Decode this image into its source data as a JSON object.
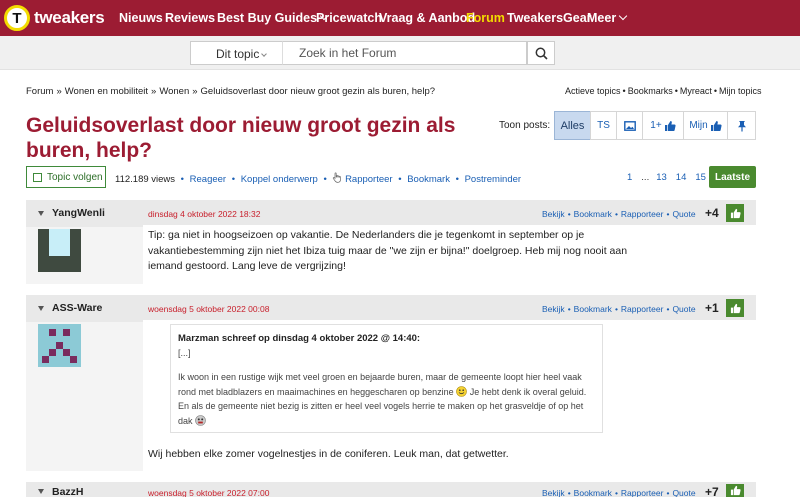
{
  "nav": {
    "logo_glyph": "T",
    "logo_text": "tweakers",
    "items": [
      "Nieuws",
      "Reviews",
      "Best Buy Guides",
      "Pricewatch",
      "Vraag & Aanbod",
      "Forum",
      "TweakersGear",
      "Meer"
    ],
    "active_item": "Forum",
    "brand_color": "#9c1c33",
    "active_color": "#f3dc00"
  },
  "search": {
    "scope": "Dit topic",
    "placeholder": "Zoek in het Forum",
    "icon": "search-icon"
  },
  "breadcrumb": [
    "Forum",
    "Wonen en mobiliteit",
    "Wonen",
    "Geluidsoverlast door nieuw groot gezin als buren, help?"
  ],
  "breadcrumb_separator": "»",
  "top_links": [
    "Actieve topics",
    "Bookmarks",
    "Myreact",
    "Mijn topics"
  ],
  "title": "Geluidsoverlast door nieuw groot gezin als buren, help?",
  "toon_posts": {
    "label": "Toon posts:",
    "options": [
      "Alles",
      "TS",
      "image-icon",
      "1+",
      "Mijn",
      "pin-icon"
    ],
    "selected": "Alles"
  },
  "actions": {
    "follow_label": "Topic volgen",
    "views": "112.189 views",
    "links": [
      "Reageer",
      "Koppel onderwerp",
      "Rapporteer",
      "Bookmark",
      "Postreminder"
    ]
  },
  "pagination": {
    "pages": [
      "1",
      "13",
      "14",
      "15"
    ],
    "ellipsis": "...",
    "last_label": "Laatste"
  },
  "post_action_labels": [
    "Bekijk",
    "Bookmark",
    "Rapporteer",
    "Quote"
  ],
  "posts": [
    {
      "author": "YangWenli",
      "date": "dinsdag 4 oktober 2022 18:32",
      "score": "+4",
      "text": "Tip: ga niet in hoogseizoen op vakantie. De Nederlanders die je tegenkomt in september op je vakantiebestemming zijn niet het Ibiza tuig maar de \"we zijn er bijna!\" doelgroep. Heb mij nog nooit aan iemand gestoord. Lang leve de vergrijzing!"
    },
    {
      "author": "ASS-Ware",
      "date": "woensdag 5 oktober 2022 00:08",
      "score": "+1",
      "quote": {
        "header": "Marzman schreef op dinsdag 4 oktober 2022 @ 14:40:",
        "ellipsis": "[...]",
        "text_1": "Ik woon in een rustige wijk met veel groen en bejaarde buren, maar de gemeente loopt hier heel vaak rond met bladblazers en maaimachines en heggescharen op benzine",
        "text_2": " Je hebt denk ik overal geluid. En als de gemeente niet bezig is zitten er heel veel vogels herrie te maken op het grasveldje of op het dak"
      },
      "text": "Wij hebben elke zomer vogelnestjes in de coniferen. Leuk man, dat getwetter."
    },
    {
      "author": "BazzH",
      "date": "woensdag 5 oktober 2022 07:00",
      "score": "+7"
    }
  ],
  "colors": {
    "link": "#1a5fb4",
    "date": "#c8202c",
    "like_green": "#4a8a2f"
  }
}
